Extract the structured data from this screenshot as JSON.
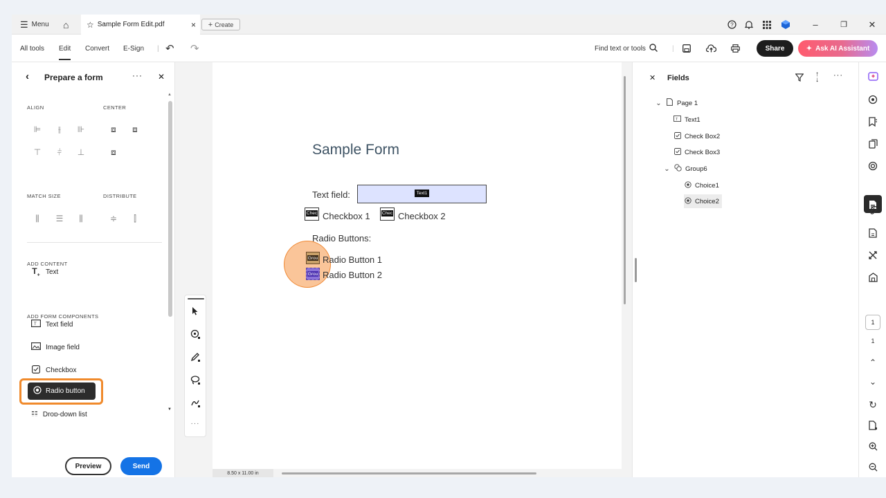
{
  "titlebar": {
    "menu_label": "Menu",
    "tab_title": "Sample Form Edit.pdf",
    "create_label": "Create"
  },
  "toolbar": {
    "all_tools": "All tools",
    "edit": "Edit",
    "convert": "Convert",
    "esign": "E-Sign",
    "find_label": "Find text or tools",
    "share_label": "Share",
    "ai_label": "Ask AI Assistant"
  },
  "left_panel": {
    "title": "Prepare a form",
    "align_label": "ALIGN",
    "center_label": "CENTER",
    "match_size_label": "MATCH SIZE",
    "distribute_label": "DISTRIBUTE",
    "add_content_label": "ADD CONTENT",
    "text_item": "Text",
    "add_form_components_label": "ADD FORM COMPONENTS",
    "components": [
      "Text field",
      "Image field",
      "Checkbox",
      "Radio button",
      "Drop-down list"
    ],
    "preview_label": "Preview",
    "send_label": "Send"
  },
  "document": {
    "title": "Sample Form",
    "text_field_label": "Text field:",
    "text_field_tag": "Text1",
    "checkbox_tag": "Chec",
    "checkbox1_label": "Checkbox 1",
    "checkbox2_label": "Checkbox 2",
    "radio_heading": "Radio Buttons:",
    "radio_tag": "Grou",
    "radio1_label": "Radio Button 1",
    "radio2_label": "Radio Button 2",
    "page_size": "8.50 x 11.00 in"
  },
  "fields_panel": {
    "title": "Fields",
    "tree": {
      "page": "Page 1",
      "text1": "Text1",
      "check_box2": "Check Box2",
      "check_box3": "Check Box3",
      "group6": "Group6",
      "choice1": "Choice1",
      "choice2": "Choice2"
    }
  },
  "right_rail": {
    "current_page": "1",
    "total_pages": "1"
  },
  "colors": {
    "accent_blue": "#1473e6",
    "highlight_orange": "#f08a2c",
    "ai_gradient_start": "#ff5b6e"
  }
}
